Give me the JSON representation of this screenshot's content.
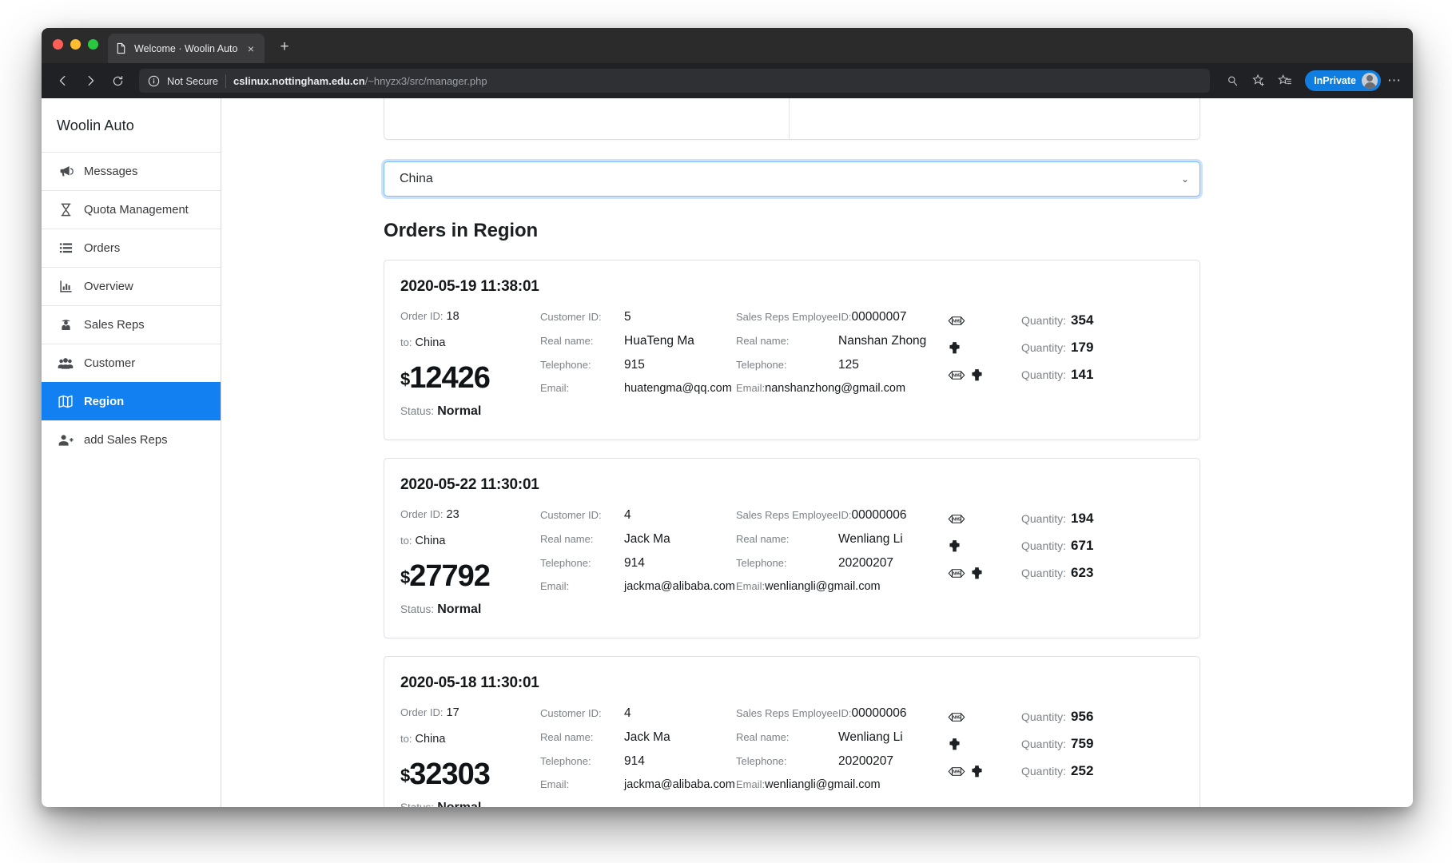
{
  "browser": {
    "tab": {
      "title": "Welcome · Woolin Auto",
      "favicon": "page-icon",
      "close": "×"
    },
    "new_tab": "+",
    "back": "←",
    "forward": "→",
    "reload": "⟳",
    "security_label": "Not Secure",
    "url_domain": "cslinux.nottingham.edu.cn",
    "url_path": "/~hnyzx3/src/manager.php",
    "inprivate_label": "InPrivate",
    "ellipsis": "⋯"
  },
  "sidebar": {
    "brand": "Woolin Auto",
    "active_color": "#1280f0",
    "items": [
      {
        "label": "Messages",
        "icon": "megaphone-icon",
        "active": false
      },
      {
        "label": "Quota Management",
        "icon": "hourglass-icon",
        "active": false
      },
      {
        "label": "Orders",
        "icon": "list-icon",
        "active": false
      },
      {
        "label": "Overview",
        "icon": "bar-chart-icon",
        "active": false
      },
      {
        "label": "Sales Reps",
        "icon": "user-tie-icon",
        "active": false
      },
      {
        "label": "Customer",
        "icon": "users-icon",
        "active": false
      },
      {
        "label": "Region",
        "icon": "map-icon",
        "active": true
      },
      {
        "label": "add Sales Reps",
        "icon": "user-plus-icon",
        "active": false
      }
    ]
  },
  "main": {
    "region_select": {
      "value": "China",
      "caret": "⌄"
    },
    "section_title": "Orders in Region",
    "labels": {
      "order_id": "Order ID:",
      "to": "to:",
      "status": "Status:",
      "customer_id": "Customer ID:",
      "real_name": "Real name:",
      "telephone": "Telephone:",
      "email": "Email:",
      "sales_rep_id": "Sales Reps EmployeeID:",
      "quantity": "Quantity:",
      "currency": "$"
    },
    "orders": [
      {
        "date": "2020-05-19 11:38:01",
        "order_id": "18",
        "to": "China",
        "price": "12426",
        "status": "Normal",
        "customer": {
          "id": "5",
          "real_name": "HuaTeng Ma",
          "telephone": "915",
          "email": "huatengma@qq.com"
        },
        "sales_rep": {
          "id": "00000007",
          "real_name": "Nanshan Zhong",
          "telephone": "125",
          "email": "nanshanzhong@gmail.com"
        },
        "items": [
          {
            "icons": [
              "n95-mask-icon"
            ],
            "quantity": "354"
          },
          {
            "icons": [
              "medical-cross-icon"
            ],
            "quantity": "179"
          },
          {
            "icons": [
              "n95-mask-icon",
              "medical-cross-icon"
            ],
            "quantity": "141"
          }
        ]
      },
      {
        "date": "2020-05-22 11:30:01",
        "order_id": "23",
        "to": "China",
        "price": "27792",
        "status": "Normal",
        "customer": {
          "id": "4",
          "real_name": "Jack Ma",
          "telephone": "914",
          "email": "jackma@alibaba.com"
        },
        "sales_rep": {
          "id": "00000006",
          "real_name": "Wenliang Li",
          "telephone": "20200207",
          "email": "wenliangli@gmail.com"
        },
        "items": [
          {
            "icons": [
              "n95-mask-icon"
            ],
            "quantity": "194"
          },
          {
            "icons": [
              "medical-cross-icon"
            ],
            "quantity": "671"
          },
          {
            "icons": [
              "n95-mask-icon",
              "medical-cross-icon"
            ],
            "quantity": "623"
          }
        ]
      },
      {
        "date": "2020-05-18 11:30:01",
        "order_id": "17",
        "to": "China",
        "price": "32303",
        "status": "Normal",
        "customer": {
          "id": "4",
          "real_name": "Jack Ma",
          "telephone": "914",
          "email": "jackma@alibaba.com"
        },
        "sales_rep": {
          "id": "00000006",
          "real_name": "Wenliang Li",
          "telephone": "20200207",
          "email": "wenliangli@gmail.com"
        },
        "items": [
          {
            "icons": [
              "n95-mask-icon"
            ],
            "quantity": "956"
          },
          {
            "icons": [
              "medical-cross-icon"
            ],
            "quantity": "759"
          },
          {
            "icons": [
              "n95-mask-icon",
              "medical-cross-icon"
            ],
            "quantity": "252"
          }
        ]
      }
    ]
  }
}
